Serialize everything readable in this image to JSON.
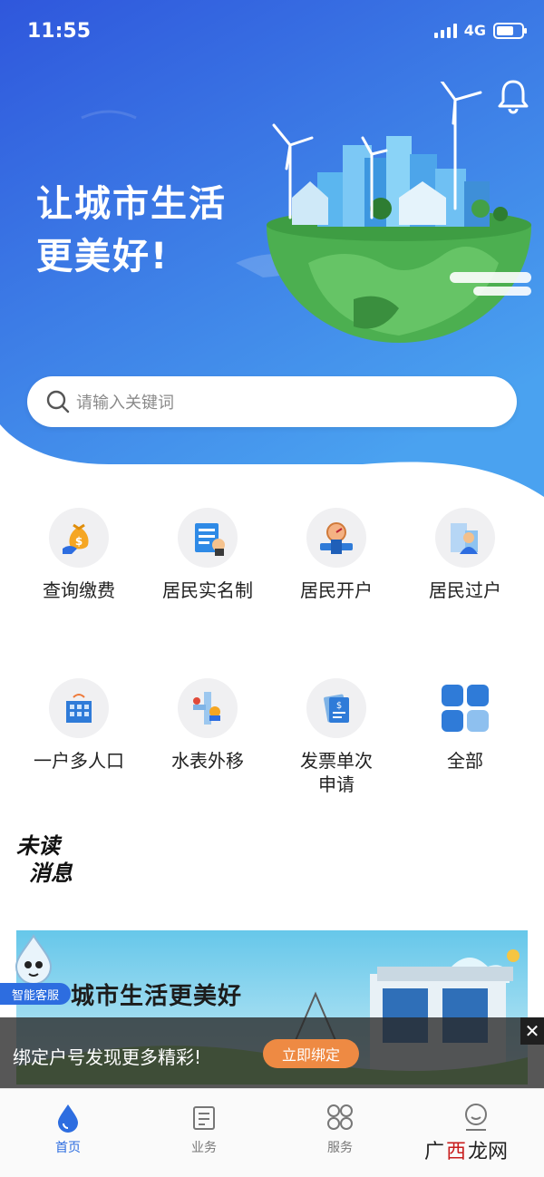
{
  "status_bar": {
    "time": "11:55",
    "network": "4G"
  },
  "hero": {
    "slogan_line1": "让城市生活",
    "slogan_line2": "更美好!"
  },
  "search": {
    "placeholder": "请输入关键词"
  },
  "services_row1": [
    {
      "label": "查询缴费",
      "icon": "money-bag-icon"
    },
    {
      "label": "居民实名制",
      "icon": "id-card-icon"
    },
    {
      "label": "居民开户",
      "icon": "water-meter-icon"
    },
    {
      "label": "居民过户",
      "icon": "person-building-icon"
    }
  ],
  "services_row2": [
    {
      "label": "一户多人口",
      "icon": "building-icon"
    },
    {
      "label": "水表外移",
      "icon": "pipe-meter-icon"
    },
    {
      "label": "发票单次\n申请",
      "icon": "invoice-icon"
    },
    {
      "label": "全部",
      "icon": "grid-icon"
    }
  ],
  "unread": {
    "line1": "未读",
    "line2": "消息"
  },
  "banner": {
    "text": "城市生活更美好"
  },
  "customer_service": {
    "label": "智能客服"
  },
  "bind_bar": {
    "text": "绑定户号发现更多精彩!",
    "button": "立即绑定",
    "close": "✕"
  },
  "tabbar": [
    {
      "label": "首页",
      "active": true
    },
    {
      "label": "业务",
      "active": false
    },
    {
      "label": "服务",
      "active": false
    },
    {
      "label": "",
      "active": false
    }
  ],
  "watermark": {
    "part1": "广",
    "part2": "西",
    "part3": "龙网"
  },
  "colors": {
    "primary": "#2d6de0",
    "hero_top": "#3563e0",
    "hero_bottom": "#4f9bee",
    "accent_orange": "#ee8a43"
  }
}
